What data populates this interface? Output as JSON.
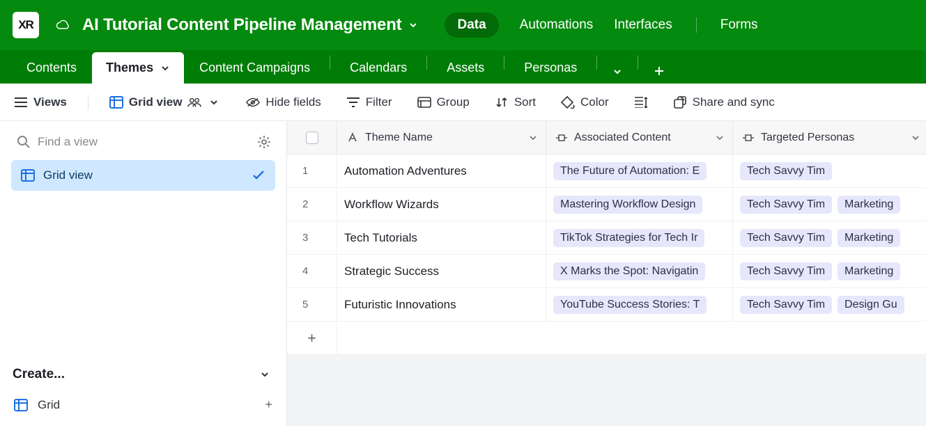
{
  "app": {
    "logo_text": "XR",
    "title": "AI Tutorial Content Pipeline Management",
    "nav": {
      "data": "Data",
      "automations": "Automations",
      "interfaces": "Interfaces",
      "forms": "Forms"
    }
  },
  "tables": {
    "contents": "Contents",
    "themes": "Themes",
    "campaigns": "Content Campaigns",
    "calendars": "Calendars",
    "assets": "Assets",
    "personas": "Personas"
  },
  "toolbar": {
    "views": "Views",
    "grid_view": "Grid view",
    "hide_fields": "Hide fields",
    "filter": "Filter",
    "group": "Group",
    "sort": "Sort",
    "color": "Color",
    "share": "Share and sync"
  },
  "sidebar": {
    "search_placeholder": "Find a view",
    "active_view": "Grid view",
    "create_label": "Create...",
    "grid_option": "Grid"
  },
  "columns": {
    "theme_name": "Theme Name",
    "associated_content": "Associated Content",
    "targeted_personas": "Targeted Personas"
  },
  "rows": [
    {
      "num": "1",
      "theme": "Automation Adventures",
      "content": [
        "The Future of Automation: E"
      ],
      "personas": [
        "Tech Savvy Tim"
      ]
    },
    {
      "num": "2",
      "theme": "Workflow Wizards",
      "content": [
        "Mastering Workflow Design"
      ],
      "personas": [
        "Tech Savvy Tim",
        "Marketing "
      ]
    },
    {
      "num": "3",
      "theme": "Tech Tutorials",
      "content": [
        "TikTok Strategies for Tech Ir"
      ],
      "personas": [
        "Tech Savvy Tim",
        "Marketing "
      ]
    },
    {
      "num": "4",
      "theme": "Strategic Success",
      "content": [
        "X Marks the Spot: Navigatin"
      ],
      "personas": [
        "Tech Savvy Tim",
        "Marketing "
      ]
    },
    {
      "num": "5",
      "theme": "Futuristic Innovations",
      "content": [
        "YouTube Success Stories: T"
      ],
      "personas": [
        "Tech Savvy Tim",
        "Design Gu"
      ]
    }
  ]
}
